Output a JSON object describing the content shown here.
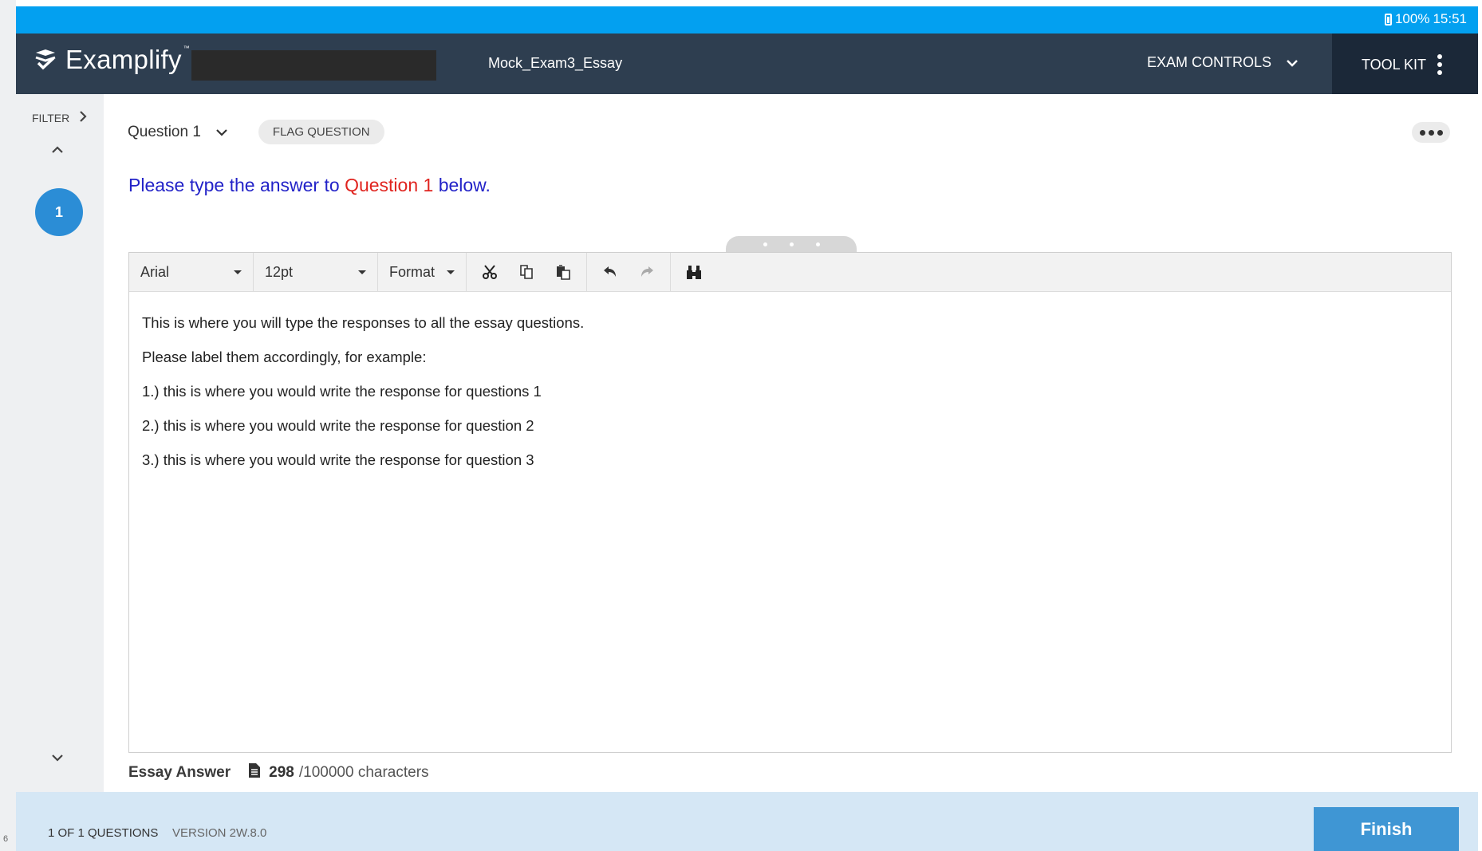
{
  "status": {
    "battery": "100%",
    "time": "15:51"
  },
  "header": {
    "brand": "Examplify",
    "trademark": "™",
    "exam_title": "Mock_Exam3_Essay",
    "exam_controls_label": "EXAM CONTROLS",
    "toolkit_label": "TOOL KIT"
  },
  "sidebar": {
    "filter_label": "FILTER",
    "questions": [
      "1"
    ]
  },
  "question": {
    "select_label": "Question 1",
    "flag_label": "FLAG QUESTION",
    "prompt": {
      "before": "Please type the answer to ",
      "highlight": "Question 1",
      "after": " below."
    }
  },
  "editor": {
    "font": "Arial",
    "size": "12pt",
    "format_label": "Format",
    "toolbar_icons": [
      "cut-icon",
      "copy-icon",
      "paste-icon",
      "undo-icon",
      "redo-icon",
      "find-icon"
    ],
    "lines": [
      "This is where you will type the responses to all the essay questions.",
      "Please label them accordingly, for example:",
      "1.) this is where you would write the response for questions 1",
      "2.) this is where you would write the response for question 2",
      "3.) this is where you would write the response for question 3"
    ]
  },
  "answer_info": {
    "label": "Essay Answer",
    "count": "298",
    "limit": "/100000 characters"
  },
  "footer": {
    "progress": "1 OF 1 QUESTIONS",
    "version": "VERSION 2W.8.0",
    "finish_label": "Finish"
  },
  "gutter_mark": "6",
  "colors": {
    "status_bar": "#03a0f0",
    "header": "#2e3e50",
    "toolkit": "#1b2838",
    "accent": "#2b8dd6",
    "prompt_text": "#2323c8",
    "prompt_highlight": "#e0241f",
    "footer_bg": "#d5e7f5",
    "finish_button": "#3f96d4"
  }
}
